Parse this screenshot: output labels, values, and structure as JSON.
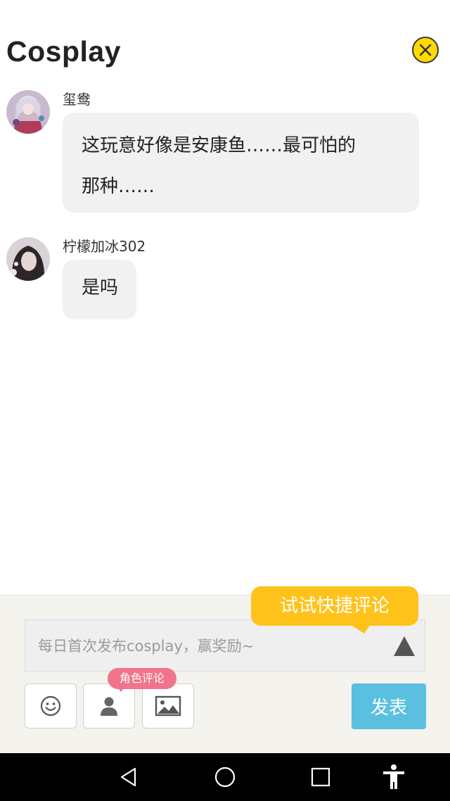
{
  "header": {
    "title": "Cosplay",
    "close_icon": "close-icon"
  },
  "comments": [
    {
      "username": "玺鸯",
      "text_line1": "这玩意好像是安康鱼……最可怕的",
      "text_line2": "那种……",
      "avatar": "avatar-girl-pink"
    },
    {
      "username": "柠檬加冰302",
      "text": "是吗",
      "avatar": "avatar-girl-dark"
    }
  ],
  "composer": {
    "placeholder": "每日首次发布cosplay，赢奖励~",
    "value": "",
    "tip": "试试快捷评论",
    "role_badge": "角色评论",
    "send_label": "发表",
    "tools": [
      "emoji-icon",
      "person-icon",
      "image-icon"
    ],
    "expand_icon": "triangle-up-icon"
  },
  "navbar": {
    "buttons": [
      "back-icon",
      "home-icon",
      "recents-icon",
      "accessibility-icon"
    ]
  },
  "colors": {
    "accent_yellow": "#ffc21a",
    "send_blue": "#5bc0e0",
    "badge_pink": "#f0748c",
    "bubble_gray": "#f1f1f1"
  }
}
